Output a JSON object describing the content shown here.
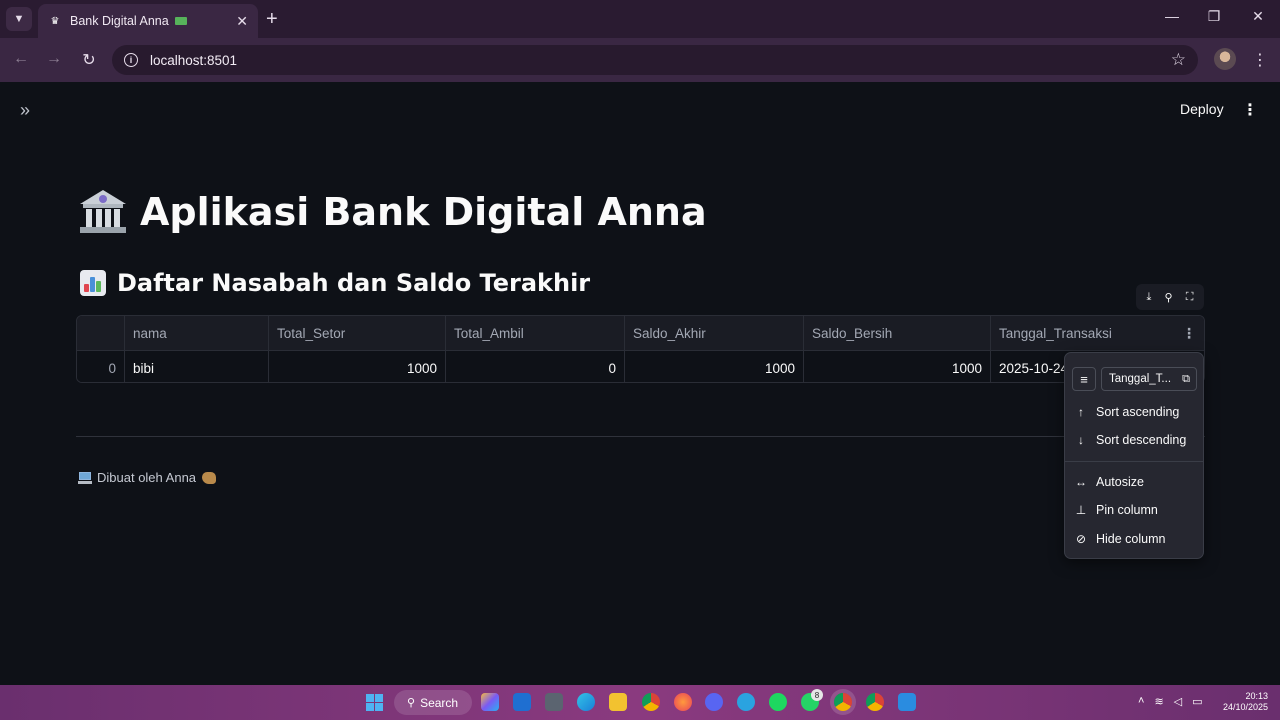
{
  "browser": {
    "tab_title": "Bank Digital Anna",
    "tab_close": "✕",
    "new_tab": "+",
    "url": "localhost:8501",
    "window_controls": [
      "—",
      "❐",
      "✕"
    ]
  },
  "app": {
    "deploy_label": "Deploy",
    "title": "Aplikasi Bank Digital Anna",
    "subheader": "Daftar Nasabah dan Saldo Terakhir",
    "footer": "Dibuat oleh Anna"
  },
  "table": {
    "columns": [
      "",
      "nama",
      "Total_Setor",
      "Total_Ambil",
      "Saldo_Akhir",
      "Saldo_Bersih",
      "Tanggal_Transaksi"
    ],
    "rows": [
      [
        "0",
        "bibi",
        "1000",
        "0",
        "1000",
        "1000",
        "2025-10-24"
      ]
    ]
  },
  "column_menu": {
    "column_name": "Tanggal_T...",
    "items": [
      {
        "label": "Sort ascending",
        "icon": "↑"
      },
      {
        "label": "Sort descending",
        "icon": "↓"
      },
      {
        "label": "Autosize",
        "icon": "↔"
      },
      {
        "label": "Pin column",
        "icon": "⊥"
      },
      {
        "label": "Hide column",
        "icon": "⊘"
      }
    ]
  },
  "taskbar": {
    "search_label": "Search",
    "whatsapp_badge": "8",
    "time": "20:13",
    "date": "24/10/2025"
  },
  "colors": {
    "background": "#0e1117",
    "tab_bar": "#2a1b31",
    "taskbar": "#8a3a7f",
    "menu_bg": "#262730"
  }
}
